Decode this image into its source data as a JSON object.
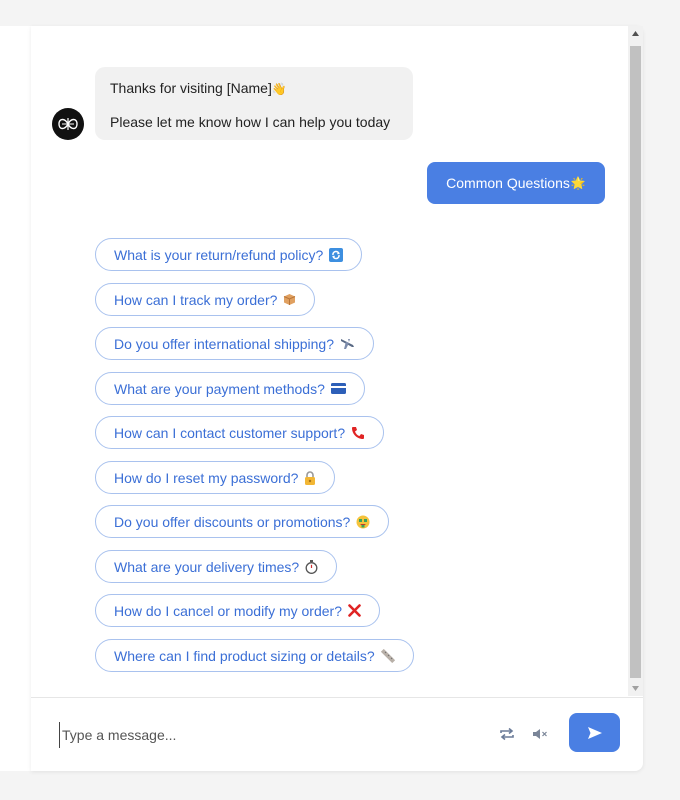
{
  "conversation": {
    "bot_message": {
      "line1": "Thanks for visiting [Name]",
      "line1_emoji": "👋",
      "line2": "Please let me know how I can help you today"
    },
    "user_message": {
      "text": "Common Questions",
      "emoji": "🌟"
    }
  },
  "quick_replies": [
    {
      "text": "What is your return/refund policy?",
      "emoji": "refresh-icon"
    },
    {
      "text": "How can I track my order?",
      "emoji": "package-icon"
    },
    {
      "text": "Do you offer international shipping?",
      "emoji": "airplane-icon"
    },
    {
      "text": "What are your payment methods?",
      "emoji": "credit-card-icon"
    },
    {
      "text": "How can I contact customer support?",
      "emoji": "phone-icon"
    },
    {
      "text": "How do I reset my password?",
      "emoji": "lock-icon"
    },
    {
      "text": "Do you offer discounts or promotions?",
      "emoji": "money-face-icon"
    },
    {
      "text": "What are your delivery times?",
      "emoji": "stopwatch-icon"
    },
    {
      "text": "How do I cancel or modify my order?",
      "emoji": "cross-mark-icon"
    },
    {
      "text": "Where can I find product sizing or details?",
      "emoji": "ruler-icon"
    }
  ],
  "input": {
    "placeholder": "Type a message..."
  },
  "colors": {
    "accent": "#4a7fe3",
    "chip_border": "#a9c2ee",
    "chip_text": "#3b6fd6",
    "bot_bubble": "#f1f1f1",
    "cancel_red": "#e02424"
  }
}
